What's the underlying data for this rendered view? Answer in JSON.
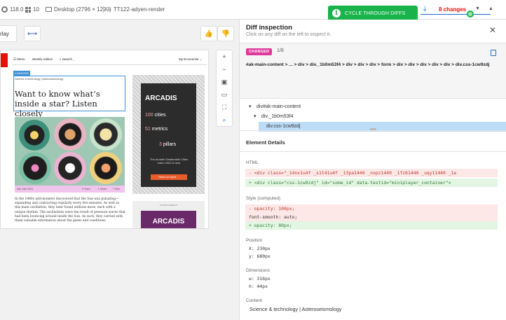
{
  "topbar": {
    "browser_version": "118.0",
    "os_version": "10",
    "viewport": "Desktop (2796 × 1290)",
    "branch": "TT122-adyen-render",
    "changes": "8 changes"
  },
  "toast": {
    "label": "CYCLE THROUGH DIFFS"
  },
  "left": {
    "overlay_label": "rlay"
  },
  "article": {
    "nav_menu": "Menu",
    "nav_weekly": "Weekly edition",
    "nav_search": "Search",
    "nav_account": "My Economist",
    "changed_tag": "CHANGED",
    "section": "Science & technology | Asteroseismology",
    "headline": "Want to know what’s inside a star? Listen closely",
    "date": "Sep 14th 2023",
    "body": "In the 1960s astronomers discovered that the Sun was pulsating—expanding and contracting regularly every five minutes. As well as this main oscillation, they later found millions more, each with a unique rhythm. The oscillations were the result of pressure waves that had been bouncing around inside the Sun. As such, they carried with them valuable information about the gases and conditions",
    "ad_brand": "ARCADIS",
    "ad_stat1_num": "100",
    "ad_stat1_label": "cities",
    "ad_stat2_num": "51",
    "ad_stat2_label": "metrics",
    "ad_stat3_num": "3",
    "ad_stat3_label": "pillars",
    "ad_tagline": "The Arcadis Sustainable Cities Index 2022 is here",
    "ad_cta": "Read our report →",
    "ad2_label": "ADVERTISEMENT",
    "ad2_brand": "ARCADIS"
  },
  "panel": {
    "title": "Diff inspection",
    "subtitle": "Click on any diff on the left to inspect it.",
    "badge": "CHANGED",
    "count": "1/8",
    "path": "#ak-main-content > ... > div > div._1b0m53f4 > div > div > div > form > div > div > div > div > div > div.css-1cw9zdj",
    "tree": [
      "div#ak-main-content",
      "div._1b0m53f4",
      "div.css-1cw9zdj"
    ],
    "details_heading": "Element Details",
    "html_label": "HTML",
    "html_old": "- <div class=\"_14nx1u4f _s1t41u4f _13pa1440 _nopz1440 _1fz61440 _uqy11440 _1e",
    "html_new": "+ <div class=\"css-1cw9zdj\" id=\"some_id\" data-testid=\"miniplayer_container\">",
    "style_label": "Style (computed)",
    "style_old": "- opacity: 100px;",
    "style_neutral": "  font-smooth: auto;",
    "style_new": "+ opacity: 80px;",
    "position_label": "Position",
    "pos_x": "X: 230px",
    "pos_y": "y: 680px",
    "dimensions_label": "Dimensions",
    "dim_w": "w: 316px",
    "dim_h": "h: 44px",
    "content_label": "Content",
    "content_value": "Science & technology | Asteroseismology"
  },
  "colors": {
    "accent": "#1a6fd8",
    "changed": "#e0399b",
    "toast": "#19b24b",
    "changes_text": "#e3120b"
  }
}
